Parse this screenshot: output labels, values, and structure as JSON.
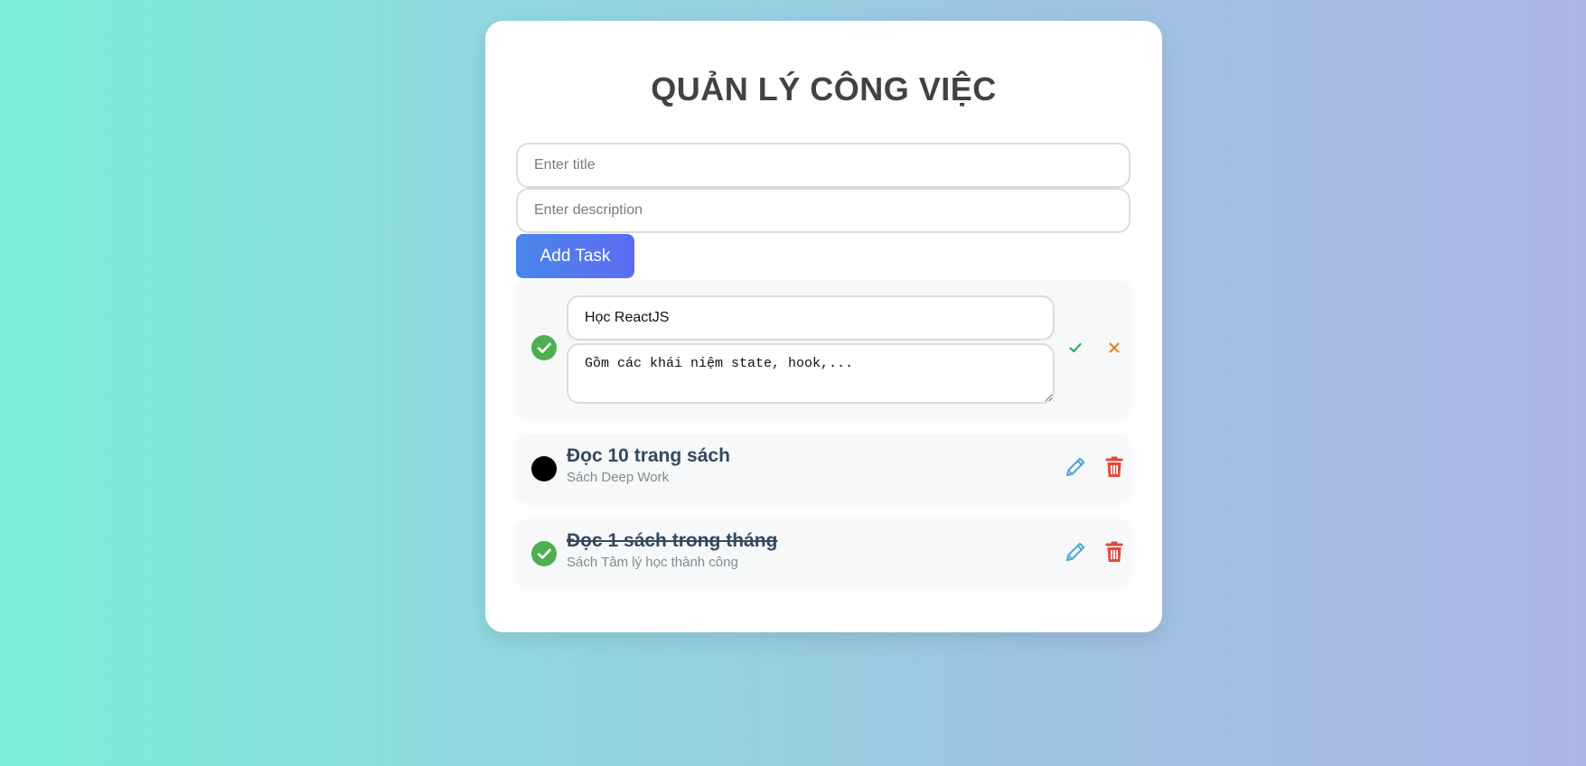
{
  "app": {
    "title": "QUẢN LÝ CÔNG VIỆC"
  },
  "form": {
    "title_placeholder": "Enter title",
    "title_value": "",
    "description_placeholder": "Enter description",
    "description_value": "",
    "add_button_label": "Add Task"
  },
  "editing_task": {
    "completed": true,
    "title_value": "Học ReactJS",
    "description_value": "Gồm các khái niệm state, hook,...",
    "save_icon": "check-icon",
    "cancel_icon": "close-icon"
  },
  "tasks": [
    {
      "title": "Đọc 10 trang sách",
      "description": "Sách Deep Work",
      "completed": false
    },
    {
      "title": "Đọc 1 sách trong tháng",
      "description": "Sách Tâm lý học thành công",
      "completed": true
    }
  ],
  "icons": {
    "status_done": "check-circle-icon",
    "status_todo": "circle-icon",
    "edit": "pencil-icon",
    "delete": "trash-icon"
  },
  "colors": {
    "done": "#4caf50",
    "todo": "#000000",
    "edit_icon": "#4aa3d8",
    "delete_icon": "#e04a3c",
    "save_icon": "#27ae60",
    "cancel_icon": "#e67e22",
    "add_button_start": "#4a86ea",
    "add_button_end": "#5c6cf2"
  }
}
